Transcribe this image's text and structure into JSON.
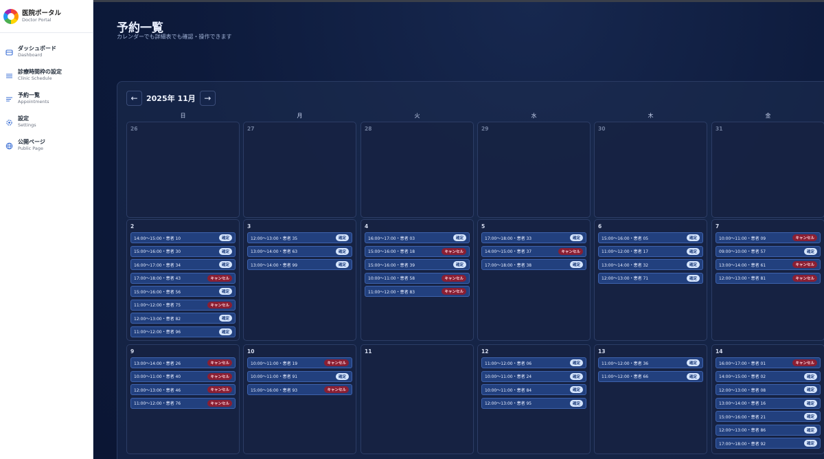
{
  "sidebar": {
    "brand_title": "医院ポータル",
    "brand_sub": "Doctor Portal",
    "items": [
      {
        "label": "ダッシュボード",
        "sub": "Dashboard",
        "icon": "dashboard-icon"
      },
      {
        "label": "診療時間枠の設定",
        "sub": "Clinic Schedule",
        "icon": "list-icon"
      },
      {
        "label": "予約一覧",
        "sub": "Appointments",
        "icon": "appointments-icon"
      },
      {
        "label": "設定",
        "sub": "Settings",
        "icon": "gear-icon"
      },
      {
        "label": "公開ページ",
        "sub": "Public Page",
        "icon": "globe-icon"
      }
    ]
  },
  "header": {
    "title": "予約一覧",
    "subtitle": "カレンダーでも詳細表でも確認・操作できます"
  },
  "calendar": {
    "prev_label": "←",
    "next_label": "→",
    "month_label": "2025年 11月",
    "weekdays": [
      "日",
      "月",
      "火",
      "水",
      "木",
      "金"
    ],
    "weeks": [
      [
        {
          "day": "26",
          "dim": true,
          "appts": []
        },
        {
          "day": "27",
          "dim": true,
          "appts": []
        },
        {
          "day": "28",
          "dim": true,
          "appts": []
        },
        {
          "day": "29",
          "dim": true,
          "appts": []
        },
        {
          "day": "30",
          "dim": true,
          "appts": []
        },
        {
          "day": "31",
          "dim": true,
          "appts": []
        }
      ],
      [
        {
          "day": "2",
          "appts": [
            {
              "text": "14:00〜15:00・患者 10",
              "status": "確定"
            },
            {
              "text": "15:00〜16:00・患者 30",
              "status": "確定"
            },
            {
              "text": "16:00〜17:00・患者 34",
              "status": "確定"
            },
            {
              "text": "17:00〜18:00・患者 43",
              "status": "キャンセル"
            },
            {
              "text": "15:00〜16:00・患者 56",
              "status": "確定"
            },
            {
              "text": "11:00〜12:00・患者 75",
              "status": "キャンセル"
            },
            {
              "text": "12:00〜13:00・患者 82",
              "status": "確定"
            },
            {
              "text": "11:00〜12:00・患者 96",
              "status": "確定"
            }
          ]
        },
        {
          "day": "3",
          "appts": [
            {
              "text": "12:00〜13:00・患者 35",
              "status": "確定"
            },
            {
              "text": "13:00〜14:00・患者 63",
              "status": "確定"
            },
            {
              "text": "13:00〜14:00・患者 99",
              "status": "確定"
            }
          ]
        },
        {
          "day": "4",
          "appts": [
            {
              "text": "16:00〜17:00・患者 03",
              "status": "確定"
            },
            {
              "text": "15:00〜16:00・患者 18",
              "status": "キャンセル"
            },
            {
              "text": "15:00〜16:00・患者 39",
              "status": "確定"
            },
            {
              "text": "10:00〜11:00・患者 58",
              "status": "キャンセル"
            },
            {
              "text": "11:00〜12:00・患者 83",
              "status": "キャンセル"
            }
          ]
        },
        {
          "day": "5",
          "appts": [
            {
              "text": "17:00〜18:00・患者 33",
              "status": "確定"
            },
            {
              "text": "14:00〜15:00・患者 37",
              "status": "キャンセル"
            },
            {
              "text": "17:00〜18:00・患者 38",
              "status": "確定"
            }
          ]
        },
        {
          "day": "6",
          "appts": [
            {
              "text": "15:00〜16:00・患者 05",
              "status": "確定"
            },
            {
              "text": "11:00〜12:00・患者 17",
              "status": "確定"
            },
            {
              "text": "13:00〜14:00・患者 32",
              "status": "確定"
            },
            {
              "text": "12:00〜13:00・患者 71",
              "status": "確定"
            }
          ]
        },
        {
          "day": "7",
          "appts": [
            {
              "text": "10:00〜11:00・患者 09",
              "status": "キャンセル"
            },
            {
              "text": "09:00〜10:00・患者 57",
              "status": "確定"
            },
            {
              "text": "13:00〜14:00・患者 61",
              "status": "キャンセル"
            },
            {
              "text": "12:00〜13:00・患者 81",
              "status": "キャンセル"
            }
          ]
        }
      ],
      [
        {
          "day": "9",
          "appts": [
            {
              "text": "13:00〜14:00・患者 26",
              "status": "キャンセル"
            },
            {
              "text": "10:00〜11:00・患者 40",
              "status": "キャンセル"
            },
            {
              "text": "12:00〜13:00・患者 46",
              "status": "キャンセル"
            },
            {
              "text": "11:00〜12:00・患者 76",
              "status": "キャンセル"
            }
          ]
        },
        {
          "day": "10",
          "appts": [
            {
              "text": "10:00〜11:00・患者 19",
              "status": "キャンセル"
            },
            {
              "text": "10:00〜11:00・患者 91",
              "status": "確定"
            },
            {
              "text": "15:00〜16:00・患者 93",
              "status": "キャンセル"
            }
          ]
        },
        {
          "day": "11",
          "appts": []
        },
        {
          "day": "12",
          "appts": [
            {
              "text": "11:00〜12:00・患者 06",
              "status": "確定"
            },
            {
              "text": "10:00〜11:00・患者 24",
              "status": "確定"
            },
            {
              "text": "10:00〜11:00・患者 84",
              "status": "確定"
            },
            {
              "text": "12:00〜13:00・患者 95",
              "status": "確定"
            }
          ]
        },
        {
          "day": "13",
          "appts": [
            {
              "text": "11:00〜12:00・患者 36",
              "status": "確定"
            },
            {
              "text": "11:00〜12:00・患者 66",
              "status": "確定"
            }
          ]
        },
        {
          "day": "14",
          "appts": [
            {
              "text": "16:00〜17:00・患者 01",
              "status": "キャンセル"
            },
            {
              "text": "14:00〜15:00・患者 02",
              "status": "確定"
            },
            {
              "text": "12:00〜13:00・患者 08",
              "status": "確定"
            },
            {
              "text": "13:00〜14:00・患者 16",
              "status": "確定"
            },
            {
              "text": "15:00〜16:00・患者 21",
              "status": "確定"
            },
            {
              "text": "12:00〜13:00・患者 86",
              "status": "確定"
            },
            {
              "text": "17:00〜18:00・患者 92",
              "status": "確定"
            }
          ]
        }
      ]
    ]
  }
}
